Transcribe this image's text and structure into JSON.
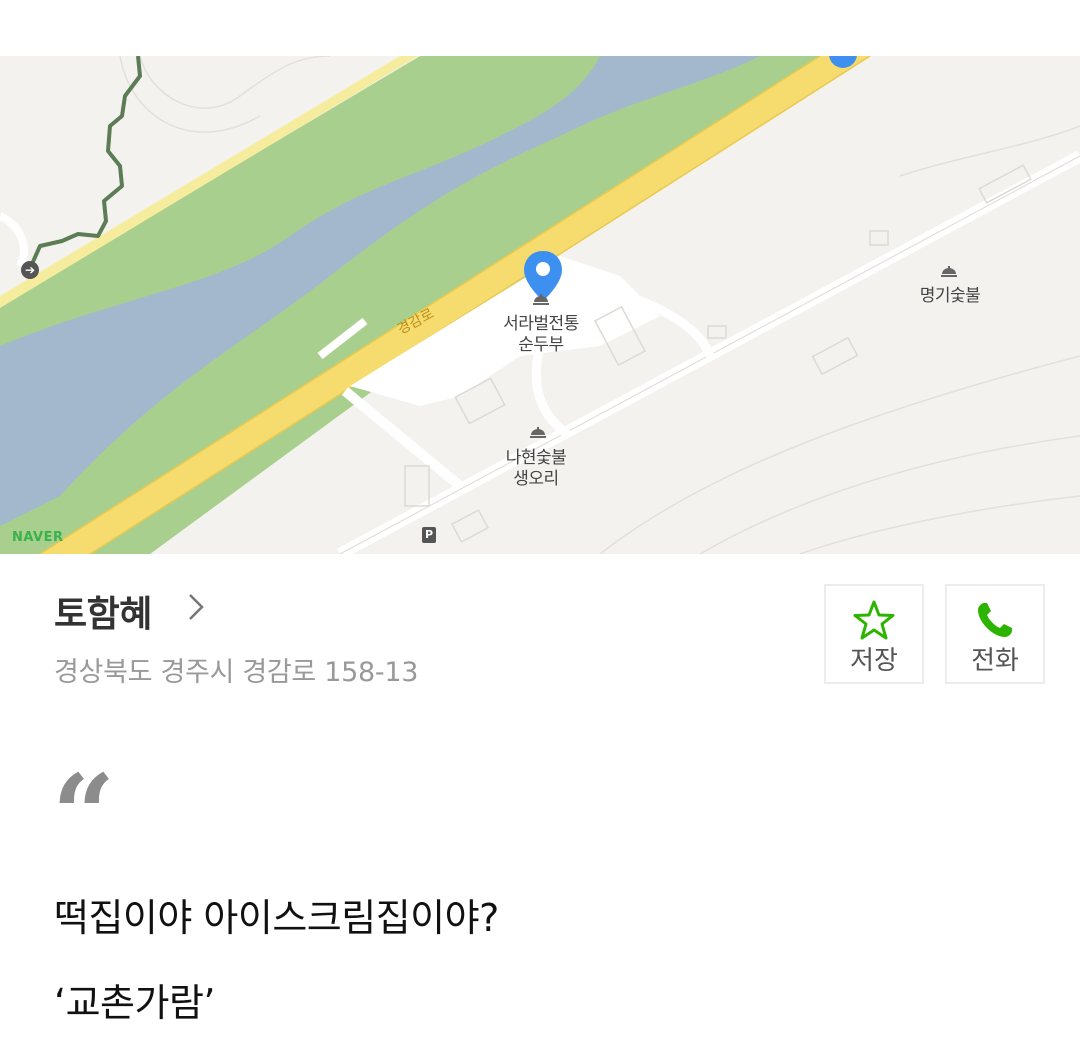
{
  "map": {
    "road_label": "경감로",
    "pois": [
      {
        "name": "서라벌전통\n순두부"
      },
      {
        "name": "명기숯불"
      },
      {
        "name": "나현숯불\n생오리"
      }
    ],
    "logo": "NAVER",
    "parking": "P"
  },
  "place": {
    "name": "토함혜",
    "address": "경상북도 경주시 경감로 158-13"
  },
  "actions": {
    "save_label": "저장",
    "call_label": "전화"
  },
  "content": {
    "quote_mark": "“",
    "line1": "떡집이야 아이스크림집이야?",
    "line2": "‘교촌가람’"
  },
  "colors": {
    "accent_green": "#2db400",
    "pin_blue": "#3d8ff0",
    "road_yellow": "#f6dc6e",
    "river_blue": "#a3b8cc",
    "park_green": "#a9cf8e"
  }
}
